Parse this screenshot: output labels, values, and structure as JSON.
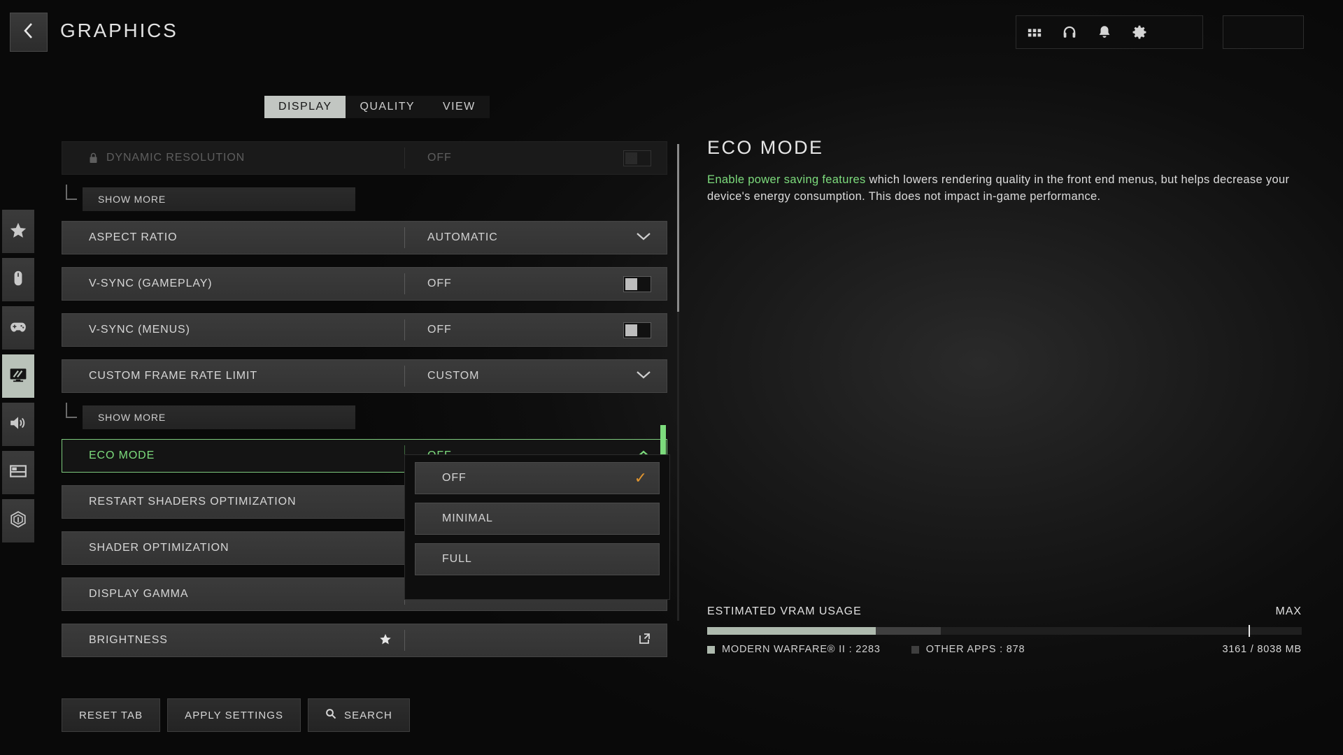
{
  "header": {
    "back_icon": "chevron-left-icon",
    "title": "GRAPHICS",
    "icons": [
      {
        "name": "grid-icon",
        "label": "Apps"
      },
      {
        "name": "headset-icon",
        "label": "Audio"
      },
      {
        "name": "bell-icon",
        "label": "Notifications"
      },
      {
        "name": "gear-icon",
        "label": "Settings"
      }
    ]
  },
  "rail": {
    "items": [
      {
        "name": "star-icon",
        "label": "Favorites",
        "active": false
      },
      {
        "name": "mouse-icon",
        "label": "Mouse & Keyboard",
        "active": false
      },
      {
        "name": "gamepad-icon",
        "label": "Controller",
        "active": false
      },
      {
        "name": "monitor-icon",
        "label": "Graphics",
        "active": true
      },
      {
        "name": "speaker-icon",
        "label": "Audio",
        "active": false
      },
      {
        "name": "layout-icon",
        "label": "Interface",
        "active": false
      },
      {
        "name": "account-icon",
        "label": "Account",
        "active": false
      }
    ]
  },
  "tabs": [
    {
      "label": "DISPLAY",
      "active": true
    },
    {
      "label": "QUALITY",
      "active": false
    },
    {
      "label": "VIEW",
      "active": false
    }
  ],
  "settings": {
    "rows": [
      {
        "label": "DYNAMIC RESOLUTION",
        "value": "OFF",
        "control": "toggle",
        "disabled": true,
        "locked": true
      },
      {
        "label": "SHOW MORE",
        "control": "sub"
      },
      {
        "label": "ASPECT RATIO",
        "value": "AUTOMATIC",
        "control": "dropdown"
      },
      {
        "label": "V-SYNC (GAMEPLAY)",
        "value": "OFF",
        "control": "toggle"
      },
      {
        "label": "V-SYNC (MENUS)",
        "value": "OFF",
        "control": "toggle"
      },
      {
        "label": "CUSTOM FRAME RATE LIMIT",
        "value": "CUSTOM",
        "control": "dropdown"
      },
      {
        "label": "SHOW MORE",
        "control": "sub"
      },
      {
        "label": "ECO MODE",
        "value": "OFF",
        "control": "dropdown",
        "highlight": true,
        "expanded": true
      },
      {
        "label": "RESTART SHADERS OPTIMIZATION",
        "value": "",
        "control": "none"
      },
      {
        "label": "SHADER OPTIMIZATION",
        "value": "",
        "control": "none"
      },
      {
        "label": "DISPLAY GAMMA",
        "value": "",
        "control": "none"
      },
      {
        "label": "BRIGHTNESS",
        "value": "",
        "control": "external",
        "starred": true
      }
    ]
  },
  "dropdown": {
    "options": [
      {
        "label": "OFF",
        "selected": true
      },
      {
        "label": "MINIMAL",
        "selected": false
      },
      {
        "label": "FULL",
        "selected": false
      }
    ],
    "check_glyph": "✓",
    "check_color": "#e0952f"
  },
  "info": {
    "title": "ECO MODE",
    "desc_highlight": "Enable power saving features",
    "desc_rest": " which lowers rendering quality in the front end menus, but helps decrease your device's energy consumption. This does not impact in-game performance.",
    "highlight_color": "#7ddc7d"
  },
  "vram": {
    "title": "ESTIMATED VRAM USAGE",
    "max_label": "MAX",
    "legend": [
      {
        "label": "MODERN WARFARE® II : 2283",
        "color": "#aebaae"
      },
      {
        "label": "OTHER APPS : 878",
        "color": "#3f3f3f"
      }
    ],
    "total": "3161 / 8038 MB",
    "game_mb": 2283,
    "other_mb": 878,
    "used_mb": 3161,
    "total_mb": 8038,
    "max_marker_pct": 91
  },
  "footer": {
    "buttons": [
      {
        "label": "RESET TAB",
        "icon": null
      },
      {
        "label": "APPLY SETTINGS",
        "icon": null
      },
      {
        "label": "SEARCH",
        "icon": "search-icon"
      }
    ]
  }
}
